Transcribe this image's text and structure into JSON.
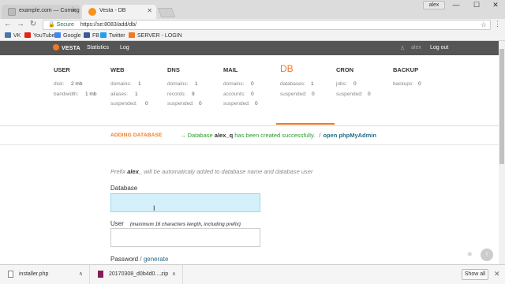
{
  "browser": {
    "tabs": [
      {
        "title": "example.com — Coming"
      },
      {
        "title": "Vesta - DB"
      }
    ],
    "user_badge": "alex",
    "omnibox": {
      "security": "Secure",
      "url": "https://se:8083/add/db/"
    },
    "bookmarks": [
      {
        "label": "VK",
        "color": "#4a76a8"
      },
      {
        "label": "YouTube",
        "color": "#e62117"
      },
      {
        "label": "Google",
        "color": "#4285f4"
      },
      {
        "label": "FB",
        "color": "#3b5998"
      },
      {
        "label": "Twitter",
        "color": "#1da1f2"
      },
      {
        "label": "SERVER - LOGIN",
        "color": "#f47820"
      }
    ]
  },
  "vesta": {
    "logo": "VESTA",
    "nav": [
      "Statistics",
      "Log"
    ],
    "user": "alex",
    "logout": "Log out",
    "accent": "#f47820",
    "stats": {
      "user": {
        "title": "USER",
        "rows": [
          {
            "k": "disk:",
            "v": "2 mb"
          },
          {
            "k": "bandwidth:",
            "v": "1 mb"
          }
        ]
      },
      "web": {
        "title": "WEB",
        "rows": [
          {
            "k": "domains:",
            "v": "1"
          },
          {
            "k": "aliases:",
            "v": "1"
          },
          {
            "k": "suspended:",
            "v": "0"
          }
        ]
      },
      "dns": {
        "title": "DNS",
        "rows": [
          {
            "k": "domains:",
            "v": "1"
          },
          {
            "k": "records:",
            "v": "9"
          },
          {
            "k": "suspended:",
            "v": "0"
          }
        ]
      },
      "mail": {
        "title": "MAIL",
        "rows": [
          {
            "k": "domains:",
            "v": "0"
          },
          {
            "k": "accounts:",
            "v": "0"
          },
          {
            "k": "suspended:",
            "v": "0"
          }
        ]
      },
      "db": {
        "title": "DB",
        "rows": [
          {
            "k": "databases:",
            "v": "1"
          },
          {
            "k": "suspended:",
            "v": "0"
          }
        ]
      },
      "cron": {
        "title": "CRON",
        "rows": [
          {
            "k": "jobs:",
            "v": "0"
          },
          {
            "k": "suspended:",
            "v": "0"
          }
        ]
      },
      "backup": {
        "title": "BACKUP",
        "rows": [
          {
            "k": "backups:",
            "v": "0"
          }
        ]
      }
    },
    "notice": {
      "heading": "ADDING DATABASE",
      "arrow": "→",
      "pre": "Database",
      "name": "alex_q",
      "post": "has been created successfully.",
      "sep": "/",
      "link": "open phpMyAdmin"
    },
    "form": {
      "prefix_pre": "Prefix",
      "prefix_name": "alex_",
      "prefix_post": "will be automaticaly added to database name and database user",
      "database_label": "Database",
      "database_value": "",
      "user_label": "User",
      "user_hint": "(maximum 16 characters length, including prefix)",
      "user_value": "",
      "password_label": "Password",
      "password_sep": "/",
      "generate": "generate"
    }
  },
  "downloads": {
    "items": [
      {
        "name": "installer.php"
      },
      {
        "name": "20170308_d0b4d0....zip"
      }
    ],
    "show_all": "Show all"
  }
}
